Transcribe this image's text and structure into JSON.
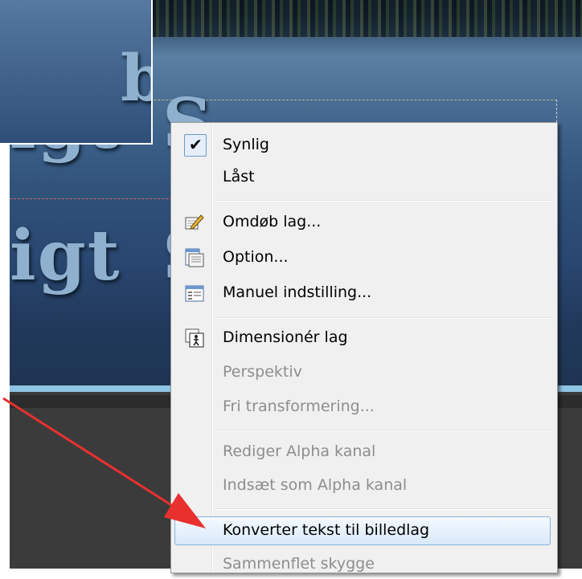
{
  "background": {
    "text_line_1": "...igt S",
    "text_line_2": "...igt S",
    "inset_text": "b"
  },
  "context_menu": {
    "items": [
      {
        "label": "Synlig",
        "checked": true,
        "enabled": true
      },
      {
        "label": "Låst",
        "enabled": true
      },
      {
        "label": "Omdøb lag...",
        "icon": "rename-pencil-icon",
        "enabled": true
      },
      {
        "label": "Option...",
        "icon": "options-window-icon",
        "enabled": true
      },
      {
        "label": "Manuel indstilling...",
        "icon": "manual-settings-window-icon",
        "enabled": true
      },
      {
        "label": "Dimensionér lag",
        "icon": "resize-layer-icon",
        "enabled": true
      },
      {
        "label": "Perspektiv",
        "enabled": false
      },
      {
        "label": "Fri transformering...",
        "enabled": false
      },
      {
        "label": "Rediger Alpha kanal",
        "enabled": false
      },
      {
        "label": "Indsæt som Alpha kanal",
        "enabled": false
      },
      {
        "label": "Konverter tekst til billedlag",
        "enabled": true,
        "highlighted": true
      },
      {
        "label": "Sammenflet skygge",
        "enabled": false
      }
    ]
  },
  "annotation": {
    "arrow_color": "#e8312f"
  }
}
